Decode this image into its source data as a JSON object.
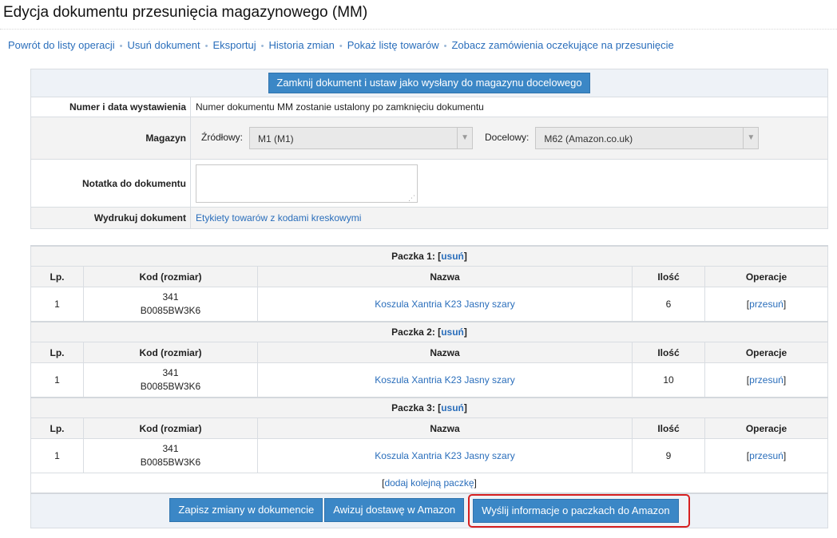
{
  "page": {
    "title": "Edycja dokumentu przesunięcia magazynowego (MM)"
  },
  "nav": [
    "Powrót do listy operacji",
    "Usuń dokument",
    "Eksportuj",
    "Historia zmian",
    "Pokaż listę towarów",
    "Zobacz zamówienia oczekujące na przesunięcie"
  ],
  "nav_separator": "•",
  "form": {
    "close_button": "Zamknij dokument i ustaw jako wysłany do magazynu docelowego",
    "number_label": "Numer i data wystawienia",
    "number_value": "Numer dokumentu MM zostanie ustalony po zamknięciu dokumentu",
    "warehouse_label": "Magazyn",
    "source_label": "Źródłowy:",
    "source_value": "M1 (M1)",
    "target_label": "Docelowy:",
    "target_value": "M62 (Amazon.co.uk)",
    "note_label": "Notatka do dokumentu",
    "note_value": "",
    "print_label": "Wydrukuj dokument",
    "print_link": "Etykiety towarów z kodami kreskowymi"
  },
  "columns": {
    "lp": "Lp.",
    "code": "Kod (rozmiar)",
    "name": "Nazwa",
    "qty": "Ilość",
    "ops": "Operacje"
  },
  "packages": [
    {
      "title": "Paczka 1:",
      "remove": "usuń",
      "item": {
        "lp": "1",
        "code": "341",
        "size": "B0085BW3K6",
        "name": "Koszula Xantria K23 Jasny szary",
        "qty": "6",
        "op": "przesuń"
      }
    },
    {
      "title": "Paczka 2:",
      "remove": "usuń",
      "item": {
        "lp": "1",
        "code": "341",
        "size": "B0085BW3K6",
        "name": "Koszula Xantria K23 Jasny szary",
        "qty": "10",
        "op": "przesuń"
      }
    },
    {
      "title": "Paczka 3:",
      "remove": "usuń",
      "item": {
        "lp": "1",
        "code": "341",
        "size": "B0085BW3K6",
        "name": "Koszula Xantria K23 Jasny szary",
        "qty": "9",
        "op": "przesuń"
      }
    }
  ],
  "add_package": "dodaj kolejną paczkę",
  "actions": {
    "save": "Zapisz zmiany w dokumencie",
    "notify": "Awizuj dostawę w Amazon",
    "send": "Wyślij informacje o paczkach do Amazon"
  },
  "colors": {
    "link": "#2a6ebb",
    "button": "#3b87c6",
    "highlight": "#d62020",
    "header_bg": "#eef2f7"
  }
}
